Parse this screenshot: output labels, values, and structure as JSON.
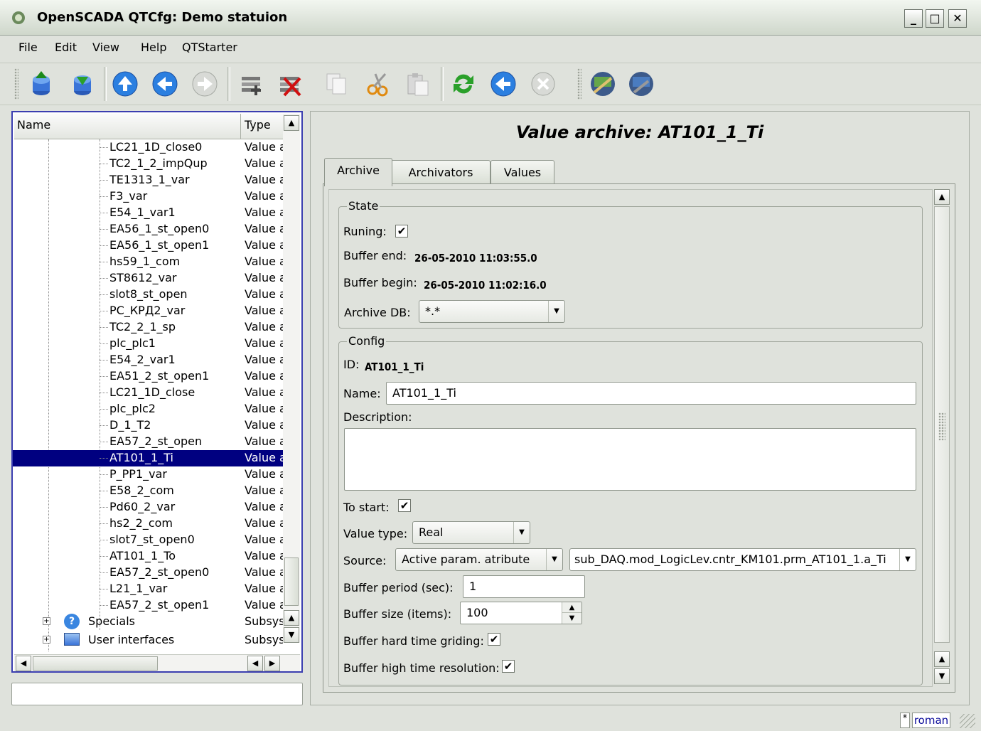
{
  "window": {
    "title": "OpenSCADA QTCfg: Demo statuion",
    "min_btn": "_",
    "max_btn": "□",
    "close_btn": "✕"
  },
  "menu": [
    "File",
    "Edit",
    "View",
    "Help",
    "QTStarter"
  ],
  "toolbar": {
    "icons": [
      "db-load-icon",
      "db-save-icon",
      "up-icon",
      "back-icon",
      "forward-icon",
      "add-item-icon",
      "delete-item-icon",
      "copy-icon",
      "cut-icon",
      "paste-icon",
      "refresh-icon",
      "start-icon",
      "stop-icon",
      "app-starter-icon-1",
      "app-starter-icon-2"
    ]
  },
  "tree": {
    "headers": {
      "name": "Name",
      "type": "Type"
    },
    "rows": [
      {
        "name": "LC21_1D_close0",
        "type": "Value archive"
      },
      {
        "name": "TC2_1_2_impQup",
        "type": "Value archive"
      },
      {
        "name": "TE1313_1_var",
        "type": "Value archive"
      },
      {
        "name": "F3_var",
        "type": "Value archive"
      },
      {
        "name": "E54_1_var1",
        "type": "Value archive"
      },
      {
        "name": "EA56_1_st_open0",
        "type": "Value archive"
      },
      {
        "name": "EA56_1_st_open1",
        "type": "Value archive"
      },
      {
        "name": "hs59_1_com",
        "type": "Value archive"
      },
      {
        "name": "ST8612_var",
        "type": "Value archive"
      },
      {
        "name": "slot8_st_open",
        "type": "Value archive"
      },
      {
        "name": "PC_КРД2_var",
        "type": "Value archive"
      },
      {
        "name": "TC2_2_1_sp",
        "type": "Value archive"
      },
      {
        "name": "plc_plc1",
        "type": "Value archive"
      },
      {
        "name": "E54_2_var1",
        "type": "Value archive"
      },
      {
        "name": "EA51_2_st_open1",
        "type": "Value archive"
      },
      {
        "name": "LC21_1D_close",
        "type": "Value archive"
      },
      {
        "name": "plc_plc2",
        "type": "Value archive"
      },
      {
        "name": "D_1_T2",
        "type": "Value archive"
      },
      {
        "name": "EA57_2_st_open",
        "type": "Value archive"
      },
      {
        "name": "AT101_1_Ti",
        "type": "Value archive",
        "selected": true
      },
      {
        "name": "P_PP1_var",
        "type": "Value archive"
      },
      {
        "name": "E58_2_com",
        "type": "Value archive"
      },
      {
        "name": "Pd60_2_var",
        "type": "Value archive"
      },
      {
        "name": "hs2_2_com",
        "type": "Value archive"
      },
      {
        "name": "slot7_st_open0",
        "type": "Value archive"
      },
      {
        "name": "AT101_1_To",
        "type": "Value archive"
      },
      {
        "name": "EA57_2_st_open0",
        "type": "Value archive"
      },
      {
        "name": "L21_1_var",
        "type": "Value archive"
      },
      {
        "name": "EA57_2_st_open1",
        "type": "Value archive"
      }
    ],
    "top_nodes": [
      {
        "name": "Specials",
        "type": "Subsystem"
      },
      {
        "name": "User interfaces",
        "type": "Subsystem"
      }
    ]
  },
  "panel": {
    "title": "Value archive: AT101_1_Ti",
    "tabs": [
      "Archive",
      "Archivators",
      "Values"
    ],
    "state": {
      "group_label": "State",
      "running_label": "Runing:",
      "running": true,
      "buffer_end_label": "Buffer end:",
      "buffer_end": "26-05-2010 11:03:55.0",
      "buffer_begin_label": "Buffer begin:",
      "buffer_begin": "26-05-2010 11:02:16.0",
      "archive_db_label": "Archive DB:",
      "archive_db": "*.*"
    },
    "config": {
      "group_label": "Config",
      "id_label": "ID:",
      "id": "AT101_1_Ti",
      "name_label": "Name:",
      "name": "AT101_1_Ti",
      "description_label": "Description:",
      "description": "",
      "to_start_label": "To start:",
      "to_start": true,
      "value_type_label": "Value type:",
      "value_type": "Real",
      "source_label": "Source:",
      "source_kind": "Active param. atribute",
      "source_path": "sub_DAQ.mod_LogicLev.cntr_KM101.prm_AT101_1.a_Ti",
      "buffer_period_label": "Buffer period (sec):",
      "buffer_period": "1",
      "buffer_size_label": "Buffer size (items):",
      "buffer_size": "100",
      "hard_grid_label": "Buffer hard time griding:",
      "hard_grid": true,
      "high_res_label": "Buffer high time resolution:",
      "high_res": true
    }
  },
  "statusbar": {
    "marker": "*",
    "user": "roman"
  }
}
